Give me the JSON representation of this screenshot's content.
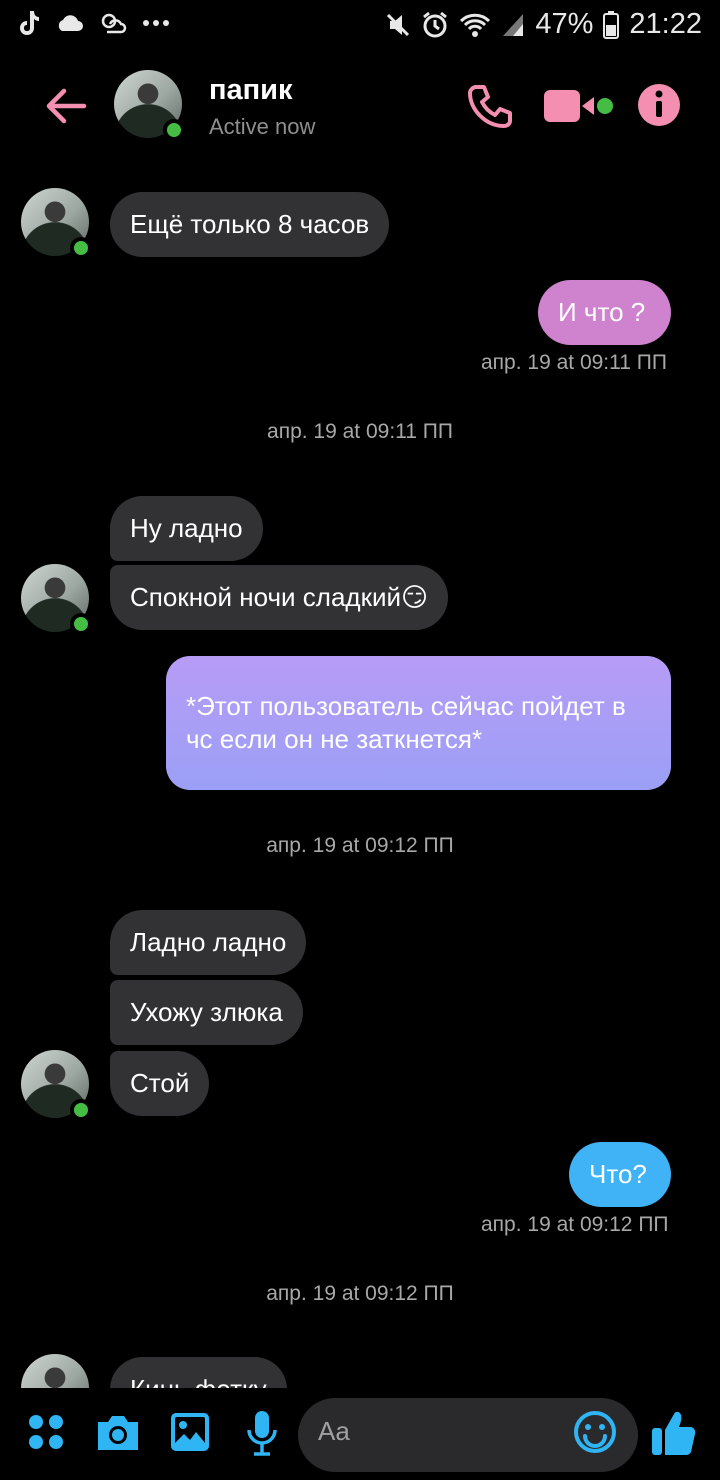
{
  "status_bar": {
    "battery": "47%",
    "time": "21:22"
  },
  "header": {
    "name": "папик",
    "status": "Active now"
  },
  "messages": {
    "m1": "Ещё только 8 часов",
    "m2": "И что ?",
    "m2_time": "апр. 19 at 09:11 ПП",
    "div1": "апр. 19 at 09:11 ПП",
    "m3": "Ну ладно",
    "m4": "Спокной ночи сладкий😏",
    "m5": "*Этот пользователь сейчас пойдет  в чс если он не заткнется*",
    "div2": "апр. 19 at 09:12 ПП",
    "m6": "Ладно ладно",
    "m7": "Ухожу злюка",
    "m8": "Стой",
    "m9": "Что?",
    "m9_time": "апр. 19 at 09:12 ПП",
    "div3": "апр. 19 at 09:12 ПП",
    "m10": "Кинь фотку"
  },
  "composer": {
    "placeholder": "Aa"
  },
  "colors": {
    "accent_pink": "#f48fb1",
    "online_green": "#45bd45",
    "incoming_bubble": "#323234",
    "blue_icons": "#2fb4f4"
  },
  "icons": [
    "tiktok-icon",
    "cloud-icon",
    "weather-icon",
    "more-dots-icon",
    "mute-icon",
    "alarm-icon",
    "wifi-icon",
    "signal-icon",
    "battery-icon",
    "back-arrow-icon",
    "phone-icon",
    "video-icon",
    "info-icon",
    "apps-icon",
    "camera-icon",
    "image-icon",
    "mic-icon",
    "emoji-icon",
    "thumbs-up-icon"
  ]
}
